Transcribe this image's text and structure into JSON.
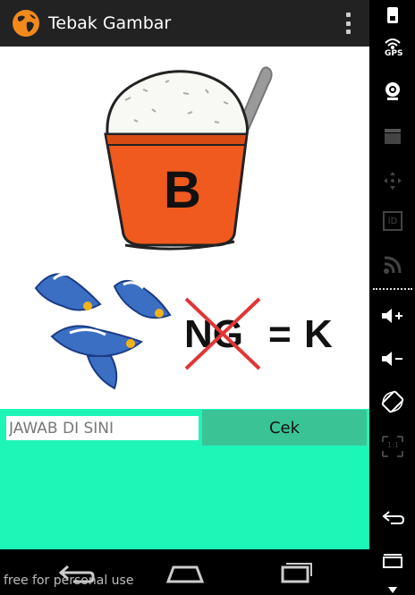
{
  "actionbar": {
    "title": "Tebak Gambar",
    "icon": "globe-icon",
    "menu_icon": "overflow-menu-icon"
  },
  "puzzle": {
    "bowl_letter": "B",
    "equation": {
      "crossed": "NG",
      "operator": "=",
      "result": "K"
    }
  },
  "answer": {
    "placeholder": "JAWAB DI SINI",
    "value": "",
    "check_label": "Cek"
  },
  "navbar": {
    "back_icon": "back-icon",
    "home_icon": "home-icon",
    "recents_icon": "recents-icon"
  },
  "watermark": "free for personal use",
  "sidebar": {
    "items": [
      {
        "icon": "phone-icon"
      },
      {
        "icon": "gps-icon",
        "label": "GPS"
      },
      {
        "icon": "webcam-icon"
      },
      {
        "icon": "video-clapper-icon"
      },
      {
        "icon": "dpad-icon"
      },
      {
        "icon": "id-icon",
        "label": "ID"
      },
      {
        "icon": "rss-icon"
      },
      {
        "icon": "volume-up-icon"
      },
      {
        "icon": "volume-down-icon"
      },
      {
        "icon": "rotate-icon"
      },
      {
        "icon": "scale-icon",
        "label": "1:1"
      },
      {
        "icon": "back-icon"
      },
      {
        "icon": "menu-icon"
      }
    ]
  },
  "colors": {
    "actionbar": "#222222",
    "answer_row": "#20f5b8",
    "check_button": "#3ac495",
    "bowl_orange": "#f05a1e"
  }
}
